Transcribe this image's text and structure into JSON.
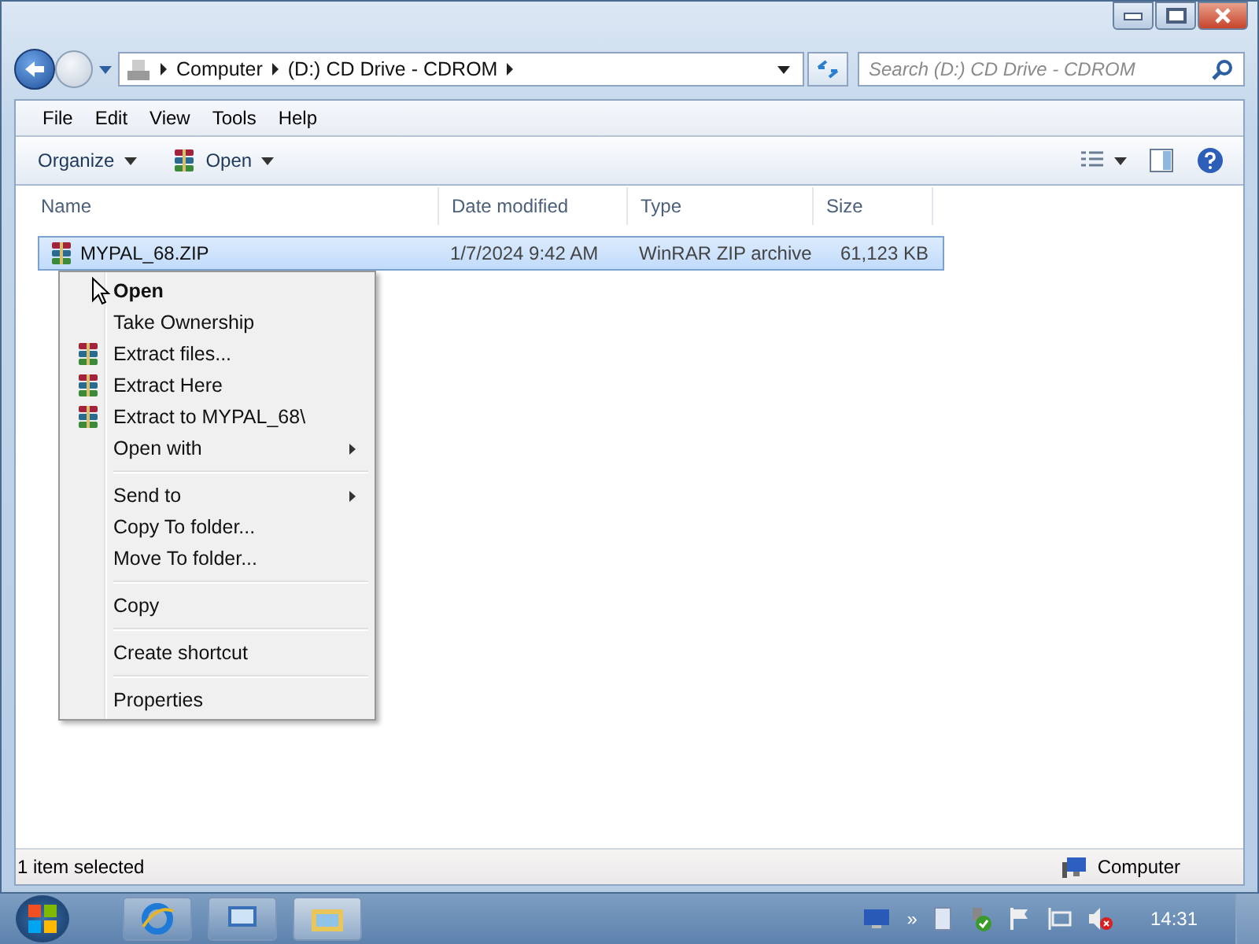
{
  "address_bar": {
    "crumbs": [
      "Computer",
      "(D:) CD Drive - CDROM"
    ]
  },
  "search": {
    "placeholder": "Search (D:) CD Drive - CDROM"
  },
  "menu_bar": [
    "File",
    "Edit",
    "View",
    "Tools",
    "Help"
  ],
  "toolbar": {
    "organize": "Organize",
    "open": "Open"
  },
  "table": {
    "columns": [
      "Name",
      "Date modified",
      "Type",
      "Size"
    ],
    "rows": [
      {
        "name": "MYPAL_68.ZIP",
        "date": "1/7/2024 9:42 AM",
        "type": "WinRAR ZIP archive",
        "size": "61,123 KB",
        "selected": true
      }
    ]
  },
  "context_menu": [
    [
      {
        "label": "Open",
        "default": true,
        "has_icon": false,
        "submenu": false
      },
      {
        "label": "Take Ownership",
        "default": false,
        "has_icon": false,
        "submenu": false
      },
      {
        "label": "Extract files...",
        "default": false,
        "has_icon": true,
        "submenu": false
      },
      {
        "label": "Extract Here",
        "default": false,
        "has_icon": true,
        "submenu": false
      },
      {
        "label": "Extract to MYPAL_68\\",
        "default": false,
        "has_icon": true,
        "submenu": false
      },
      {
        "label": "Open with",
        "default": false,
        "has_icon": false,
        "submenu": true
      }
    ],
    [
      {
        "label": "Send to",
        "default": false,
        "has_icon": false,
        "submenu": true
      },
      {
        "label": "Copy To folder...",
        "default": false,
        "has_icon": false,
        "submenu": false
      },
      {
        "label": "Move To folder...",
        "default": false,
        "has_icon": false,
        "submenu": false
      }
    ],
    [
      {
        "label": "Copy",
        "default": false,
        "has_icon": false,
        "submenu": false
      }
    ],
    [
      {
        "label": "Create shortcut",
        "default": false,
        "has_icon": false,
        "submenu": false
      }
    ],
    [
      {
        "label": "Properties",
        "default": false,
        "has_icon": false,
        "submenu": false
      }
    ]
  ],
  "status_bar": {
    "selection": "1 item selected",
    "location": "Computer"
  },
  "taskbar": {
    "clock": "14:31",
    "tray_overflow": "»"
  }
}
